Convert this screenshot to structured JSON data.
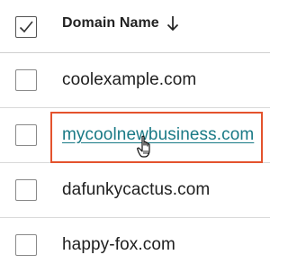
{
  "table": {
    "column_header": "Domain Name",
    "sort_direction_icon": "arrow-down-icon",
    "select_all_checked": true,
    "rows": [
      {
        "domain": "coolexample.com",
        "link": false
      },
      {
        "domain": "mycoolnewbusiness.com",
        "link": true
      },
      {
        "domain": "dafunkycactus.com",
        "link": false
      },
      {
        "domain": "happy-fox.com",
        "link": false
      }
    ]
  },
  "colors": {
    "link": "#1a7a86",
    "highlight_border": "#e4532d"
  }
}
